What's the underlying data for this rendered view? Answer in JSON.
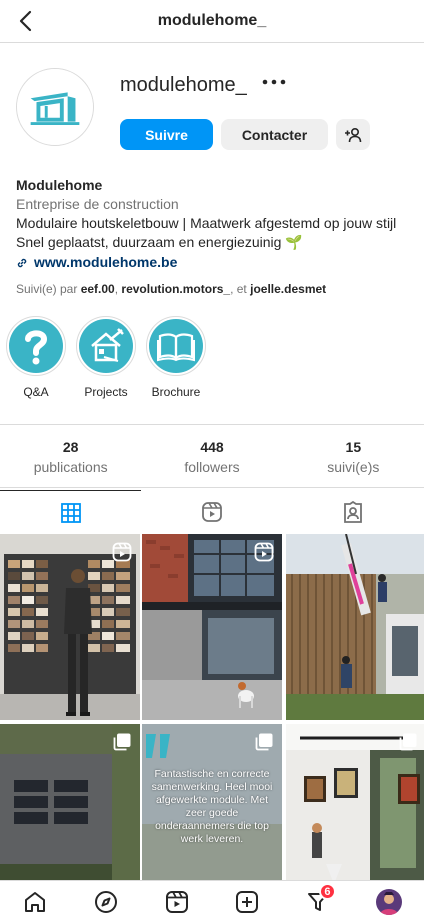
{
  "topbar": {
    "title": "modulehome_"
  },
  "profile": {
    "username": "modulehome_",
    "follow_label": "Suivre",
    "contact_label": "Contacter"
  },
  "bio": {
    "name": "Modulehome",
    "category": "Entreprise de construction",
    "line1": "Modulaire houtskeletbouw | Maatwerk afgestemd op jouw stijl",
    "line2": "Snel geplaatst, duurzaam en energiezuinig 🌱",
    "website": "www.modulehome.be"
  },
  "followed_by": {
    "prefix": "Suivi(e) par",
    "user1": "eef.00",
    "user2": "revolution.motors_",
    "sep": ", et",
    "user3": "joelle.desmet"
  },
  "highlights": [
    {
      "label": "Q&A",
      "icon": "question-icon"
    },
    {
      "label": "Projects",
      "icon": "house-tools-icon"
    },
    {
      "label": "Brochure",
      "icon": "book-icon"
    }
  ],
  "stats": [
    {
      "value": "28",
      "label": "publications"
    },
    {
      "value": "448",
      "label": "followers"
    },
    {
      "value": "15",
      "label": "suivi(e)s"
    }
  ],
  "posts": [
    {
      "type": "reel",
      "subject": "woman choosing cladding samples"
    },
    {
      "type": "reel",
      "subject": "modern building with dog"
    },
    {
      "type": "image",
      "subject": "crane lifting module"
    },
    {
      "type": "carousel",
      "subject": "aerial roof with solar panels"
    },
    {
      "type": "carousel",
      "quote": "Fantastische en correcte samenwerking. Heel mooi afgewerkte module. Met zeer goede onderaannemers die top werk leveren."
    },
    {
      "type": "carousel",
      "subject": "interior gallery room"
    }
  ],
  "bottom_nav": {
    "notification_count": "6"
  },
  "colors": {
    "accent": "#0095f6",
    "brand_teal": "#3ab4c6",
    "badge": "#ff3040"
  }
}
